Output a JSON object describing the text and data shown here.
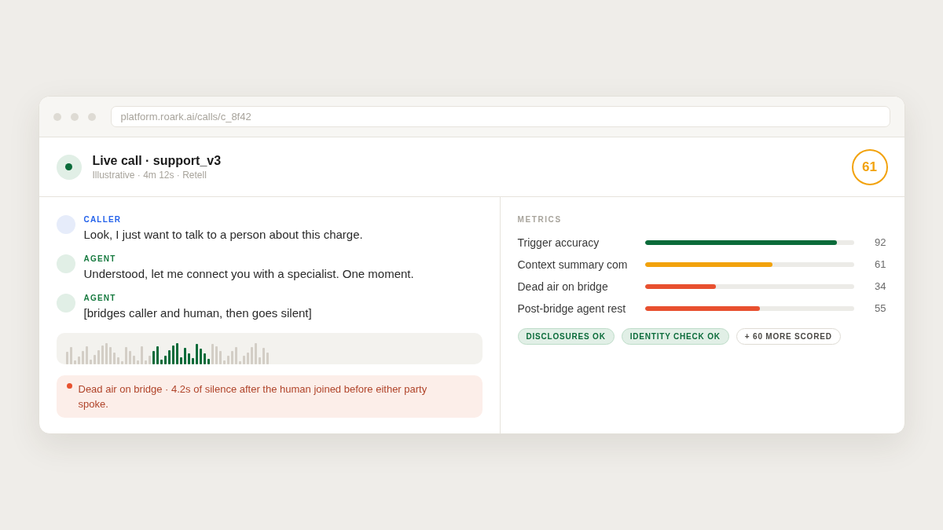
{
  "browser": {
    "url": "platform.roark.ai/calls/c_8f42"
  },
  "call": {
    "title": "Live call · support_v3",
    "subtitle": "Illustrative · 4m 12s · Retell",
    "score": "61"
  },
  "transcript": [
    {
      "kind": "caller",
      "speaker": "CALLER",
      "text": "Look, I just want to talk to a person about this charge."
    },
    {
      "kind": "agent",
      "speaker": "AGENT",
      "text": "Understood, let me connect you with a specialist. One moment."
    },
    {
      "kind": "agent",
      "speaker": "AGENT",
      "text": "[bridges caller and human, then goes silent]"
    }
  ],
  "alert": {
    "text": "Dead air on bridge · 4.2s of silence after the human joined before either party spoke."
  },
  "metrics": {
    "heading": "METRICS",
    "rows": [
      {
        "label": "Trigger accuracy",
        "level": 0.92,
        "value": "92",
        "color": "#0b6b3a"
      },
      {
        "label": "Context summary com",
        "level": 0.61,
        "value": "61",
        "color": "#f2a20c"
      },
      {
        "label": "Dead air on bridge",
        "level": 0.34,
        "value": "34",
        "color": "#e8502f"
      },
      {
        "label": "Post-bridge agent rest",
        "level": 0.55,
        "value": "55",
        "color": "#e8502f"
      }
    ],
    "tags": [
      {
        "kind": "pass",
        "label": "DISCLOSURES OK"
      },
      {
        "kind": "pass",
        "label": "IDENTITY CHECK OK"
      },
      {
        "kind": "more",
        "label": "+ 60 MORE SCORED"
      }
    ]
  }
}
